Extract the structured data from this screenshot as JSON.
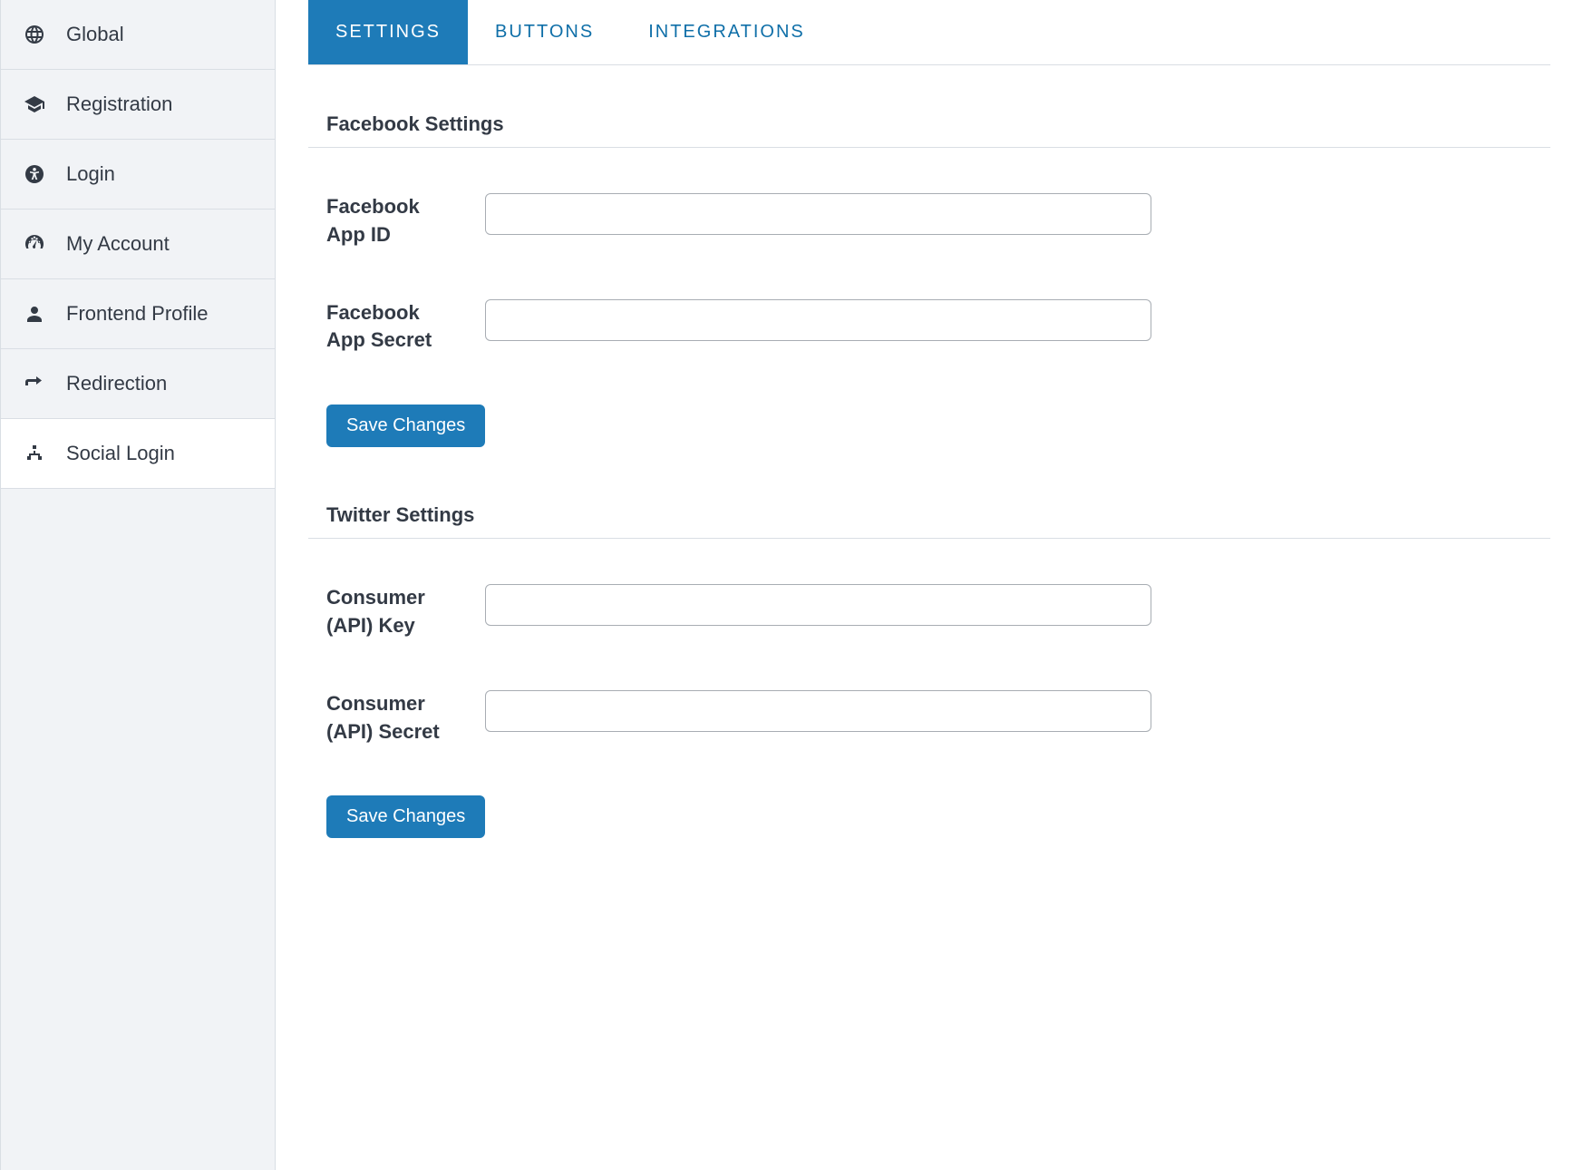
{
  "sidebar": {
    "items": [
      {
        "label": "Global"
      },
      {
        "label": "Registration"
      },
      {
        "label": "Login"
      },
      {
        "label": "My Account"
      },
      {
        "label": "Frontend Profile"
      },
      {
        "label": "Redirection"
      },
      {
        "label": "Social Login"
      }
    ]
  },
  "tabs": {
    "items": [
      {
        "label": "Settings"
      },
      {
        "label": "Buttons"
      },
      {
        "label": "Integrations"
      }
    ]
  },
  "sections": {
    "facebook": {
      "title": "Facebook Settings",
      "fields": [
        {
          "label": "Facebook App ID",
          "value": ""
        },
        {
          "label": "Facebook App Secret",
          "value": ""
        }
      ],
      "save_label": "Save Changes"
    },
    "twitter": {
      "title": "Twitter Settings",
      "fields": [
        {
          "label": "Consumer (API) Key",
          "value": ""
        },
        {
          "label": "Consumer (API) Secret",
          "value": ""
        }
      ],
      "save_label": "Save Changes"
    }
  }
}
